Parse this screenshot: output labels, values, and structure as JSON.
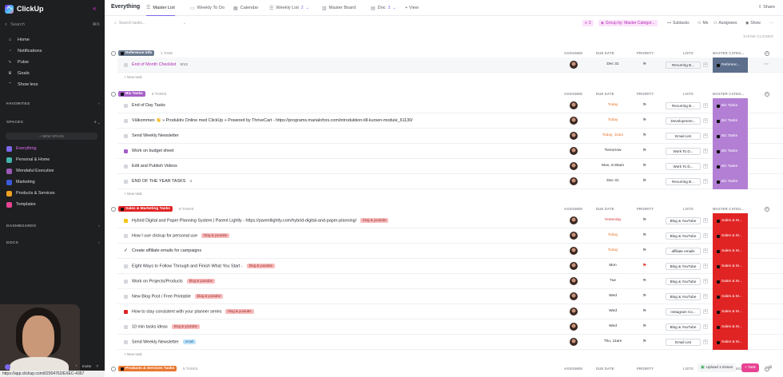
{
  "sidebar": {
    "brand": "ClickUp",
    "search_placeholder": "Search",
    "search_shortcut": "⌘K",
    "nav": [
      {
        "label": "Home",
        "icon": "home-icon"
      },
      {
        "label": "Notifications",
        "icon": "bell-icon"
      },
      {
        "label": "Pulse",
        "icon": "pulse-icon"
      },
      {
        "label": "Goals",
        "icon": "trophy-icon"
      },
      {
        "label": "Show less",
        "icon": "chevron-up-icon"
      }
    ],
    "favorites": "FAVORITES",
    "spaces": "SPACES",
    "new_space": "+ NEW SPACE",
    "space_items": [
      {
        "label": "Everything",
        "color": "#7b68ee"
      },
      {
        "label": "Personal & Home",
        "color": "#43b3ae"
      },
      {
        "label": "Wendaful Executive",
        "color": "#9b59b6"
      },
      {
        "label": "Marketing",
        "color": "#3b5bdb"
      },
      {
        "label": "Products & Services",
        "color": "#f1a022"
      },
      {
        "label": "Templates",
        "color": "#e84393"
      }
    ],
    "dashboards": "DASHBOARDS",
    "docs": "DOCS",
    "bottom": {
      "invite": "Invite"
    },
    "status_url": "https://app.clickup.com/t/2304762/EXEC-4367"
  },
  "header": {
    "title": "Everything",
    "tabs": [
      {
        "label": "Master List",
        "active": true
      },
      {
        "label": "Weekly To Do"
      },
      {
        "label": "Calendar"
      },
      {
        "label": "Weekly List",
        "count": "2"
      },
      {
        "label": "Master Board"
      },
      {
        "label": "Doc",
        "count": "3"
      },
      {
        "label": "+ View"
      }
    ],
    "share": "Share"
  },
  "toolbar": {
    "search_placeholder": "Search tasks...",
    "filter_count": "2",
    "group_by": "Group by: Master Categor...",
    "subtasks": "Subtasks",
    "me": "Me",
    "assignees": "Assignees",
    "show": "Show"
  },
  "show_closed": "SHOW CLOSED",
  "columns": {
    "assignee": "ASSIGNEE",
    "due": "DUE DATE",
    "priority": "PRIORITY",
    "lists": "LISTS",
    "master": "MASTER CATEG..."
  },
  "new_task": "+ New task",
  "groups": [
    {
      "tag": "Reference Info",
      "tag_color": "#6b7a8f",
      "count": "1 TASK",
      "mc_color": "#5c6e8c",
      "rows": [
        {
          "name": "End of Month Checklist",
          "status": "#d3d6db",
          "highlight": true,
          "extra": "0/13",
          "due": "Dec 31",
          "due_color": "",
          "list": "Recurring B...",
          "mc": "Referenc..."
        }
      ]
    },
    {
      "tag": "Biz Tasks",
      "tag_color": "#a65fc7",
      "count": "6 TASKS",
      "mc_color": "#b27fd4",
      "rows": [
        {
          "name": "End of Day Tasks",
          "status": "#d3d6db",
          "due": "Today",
          "due_color": "orange",
          "list": "Recurring B...",
          "mc": "Biz Tasks"
        },
        {
          "name": "Välkommen 👋 » Produktiv Online med ClickUp » Powered by ThriveCart - https://programs.marialofors.com/introduktion-till-kursen-module_61130/",
          "status": "#d3d6db",
          "due": "Today",
          "due_color": "orange",
          "list": "Development...",
          "mc": "Biz Tasks"
        },
        {
          "name": "Send Weekly Newsletter",
          "status": "#d3d6db",
          "due": "Today, 11am",
          "due_color": "orange",
          "list": "Email List",
          "mc": "Biz Tasks"
        },
        {
          "name": "Work on budget sheet",
          "status": "#a65fc7",
          "due": "Tomorrow",
          "due_color": "",
          "list": "Work To D...",
          "mc": "Biz Tasks"
        },
        {
          "name": "Edit and Publish Videos",
          "status": "#d3d6db",
          "due": "Mon, 8:30am",
          "due_color": "",
          "list": "Work To D...",
          "mc": "Biz Tasks"
        },
        {
          "name": "END OF THE YEAR TASKS",
          "status": "#d3d6db",
          "extra": "4",
          "due": "Dec 31",
          "due_color": "",
          "list": "Recurring B...",
          "mc": "Biz Tasks"
        }
      ]
    },
    {
      "tag": "Sales & Marketing Tasks",
      "tag_color": "#e02424",
      "count": "9 TASKS",
      "mc_color": "#e02424",
      "rows": [
        {
          "name": "Hybrid Digital and Paper Planning System | Parent Lightly - https://parentlightly.com/hybrid-digital-and-paper-planning/",
          "status": "#f5c518",
          "tag": "blog & youtube",
          "tag_type": "blog",
          "due": "Yesterday",
          "due_color": "red",
          "list": "Blog & YouTube",
          "mc": "Sales & M..."
        },
        {
          "name": "How I use clickup for personal use",
          "status": "#d3d6db",
          "tag": "blog & youtube",
          "tag_type": "blog",
          "due": "Today",
          "due_color": "orange",
          "list": "Blog & YouTube",
          "mc": "Sales & M..."
        },
        {
          "name": "Create affiliate emails for campaigns",
          "status": "#ffffff",
          "check": true,
          "due": "Today",
          "due_color": "orange",
          "list": "affiliate emails",
          "mc": "Sales & M..."
        },
        {
          "name": "Eight Ways to Follow Through and Finish What You Start -",
          "status": "#d3d6db",
          "tag": "blog & youtube",
          "tag_type": "blog",
          "due": "Mon",
          "due_color": "",
          "urgent": true,
          "list": "Blog & YouTube",
          "mc": "Sales & M..."
        },
        {
          "name": "Work on Projects/Products",
          "status": "#d3d6db",
          "tag": "blog & youtube",
          "tag_type": "blog",
          "due": "Tue",
          "due_color": "",
          "list": "Blog & YouTube",
          "mc": "Sales & M..."
        },
        {
          "name": "New Blog Post / Free Printable",
          "status": "#d3d6db",
          "tag": "blog & youtube",
          "tag_type": "blog",
          "due": "Wed",
          "due_color": "",
          "list": "Blog & YouTube",
          "mc": "Sales & M..."
        },
        {
          "name": "How to stay consistent with your planner series",
          "status": "#e02424",
          "tag": "blog & youtube",
          "tag_type": "blog",
          "due": "Wed",
          "due_color": "",
          "list": "Instagram Co...",
          "mc": "Sales & M..."
        },
        {
          "name": "10 min tasks ideas",
          "status": "#d3d6db",
          "tag": "blog & youtube",
          "tag_type": "blog",
          "due": "Wed",
          "due_color": "",
          "list": "Blog & YouTube",
          "mc": "Sales & M..."
        },
        {
          "name": "Send Weekly Newsletter",
          "status": "#d3d6db",
          "tag": "email",
          "tag_type": "email",
          "due": "Thu, 11am",
          "due_color": "",
          "list": "Email List",
          "mc": "Sales & M..."
        }
      ]
    },
    {
      "tag": "Products & Services Tasks",
      "tag_color": "#e8772e",
      "count": "5 TASKS",
      "mc_color": "#e8772e",
      "rows": []
    }
  ],
  "bottom": {
    "upload": "Upload 1 Essen",
    "task_button": "+ Task"
  }
}
